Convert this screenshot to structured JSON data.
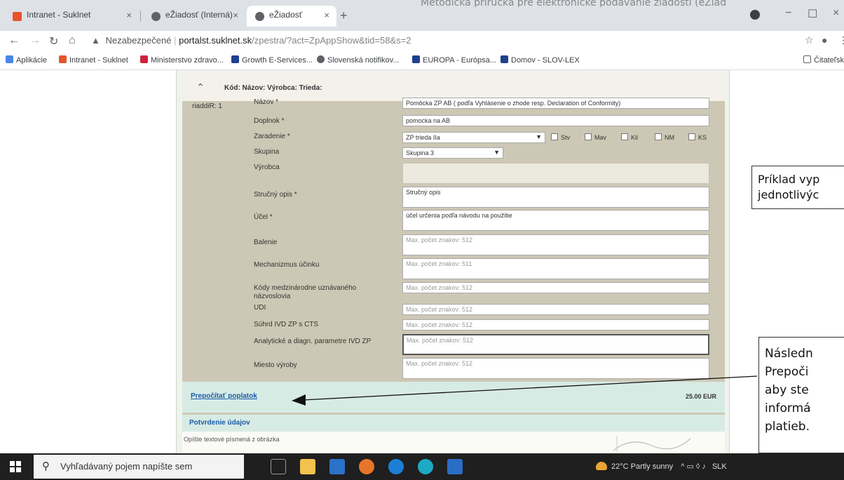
{
  "doc_header": "Metodická príručka pre elektronické podávanie žiadostí (eŽiad",
  "browser": {
    "tabs": [
      {
        "title": "Intranet - Suklnet",
        "favicon_color": "#e8542a",
        "active": false
      },
      {
        "title": "eŽiadosť (Interná)",
        "favicon_color": "#5f6368",
        "active": false
      },
      {
        "title": "eŽiadosť",
        "favicon_color": "#5f6368",
        "active": true
      }
    ],
    "tab_close": "×",
    "new_tab": "+",
    "window_controls": {
      "minimize": "−",
      "maximize": "☐",
      "close": "×"
    },
    "address": {
      "security_label": "Nezabezpečené",
      "host": "portalst.suklnet.sk",
      "path": "/zpestra/?act=ZpAppShow&tid=58&s=2"
    },
    "bookmarks": [
      {
        "label": "Aplikácie",
        "color": "#4a86e8"
      },
      {
        "label": "Intranet - Suklnet",
        "color": "#e8542a"
      },
      {
        "label": "Ministerstvo zdravo...",
        "color": "#d0213a"
      },
      {
        "label": "Growth E-Services...",
        "color": "#1f3f8f"
      },
      {
        "label": "Slovenská notifikov...",
        "color": "#5f6368"
      },
      {
        "label": "EUROPA - Európsa...",
        "color": "#1f3f8f"
      },
      {
        "label": "Domov - SLOV-LEX",
        "color": "#1f3f8f"
      }
    ],
    "reading_list": "Čitateľský zoznam"
  },
  "form": {
    "columns_header": "Kód: Názov: Výrobca: Trieda:",
    "row_id": "riaddiR: 1",
    "fields": [
      {
        "label": "Názov *",
        "value": "Pomôcka ZP AB ( podľa Vyhlásenie o zhode resp. Declaration of Conformity)"
      },
      {
        "label": "Doplnok *",
        "value": "pomocka na AB"
      },
      {
        "label": "Zaradenie *",
        "value": "ZP trieda IIa"
      },
      {
        "label": "Skupina",
        "value": "Skupina 3"
      },
      {
        "label": "Výrobca",
        "value": ""
      },
      {
        "label": "Stručný opis *",
        "value": "Stručný opis"
      },
      {
        "label": "Účel *",
        "value": "účel určenia podľa návodu na použitie"
      },
      {
        "label": "Balenie",
        "value": "Max. počet znakov: 512"
      },
      {
        "label": "Mechanizmus účinku",
        "value": "Max. počet znakov: 511"
      },
      {
        "label": "Kódy medzinárodne uznávaného názvoslovia",
        "value": "Max. počet znakov: 512"
      },
      {
        "label": "UDI",
        "value": "Max. počet znakov: 512"
      },
      {
        "label": "Súhrd IVD ZP s CTS",
        "value": "Max. počet znakov: 512"
      },
      {
        "label": "Analytické a diagn. parametre IVD ZP",
        "value": "Max. počet znakov: 512"
      },
      {
        "label": "Miesto výroby",
        "value": "Max. počet znakov: 512"
      }
    ],
    "checkboxes": [
      "Stv",
      "Mav",
      "Kil",
      "NM",
      "KS"
    ],
    "fee_link": "Prepočítať poplatok",
    "fee_amount": "25.00 EUR",
    "confirm_title": "Potvrdenie údajov",
    "confirm_text": "Opíšte textové písmená z obrázka"
  },
  "annotations": {
    "callout1": [
      "Príklad vyp",
      "jednotlivýc"
    ],
    "callout2": [
      "Následn",
      "Prepoči",
      "aby ste",
      "informá",
      "platieb."
    ]
  },
  "taskbar": {
    "search_placeholder": "Vyhľadávaný pojem napíšte sem",
    "weather": "22°C  Partly sunny",
    "lang": "SLK"
  }
}
